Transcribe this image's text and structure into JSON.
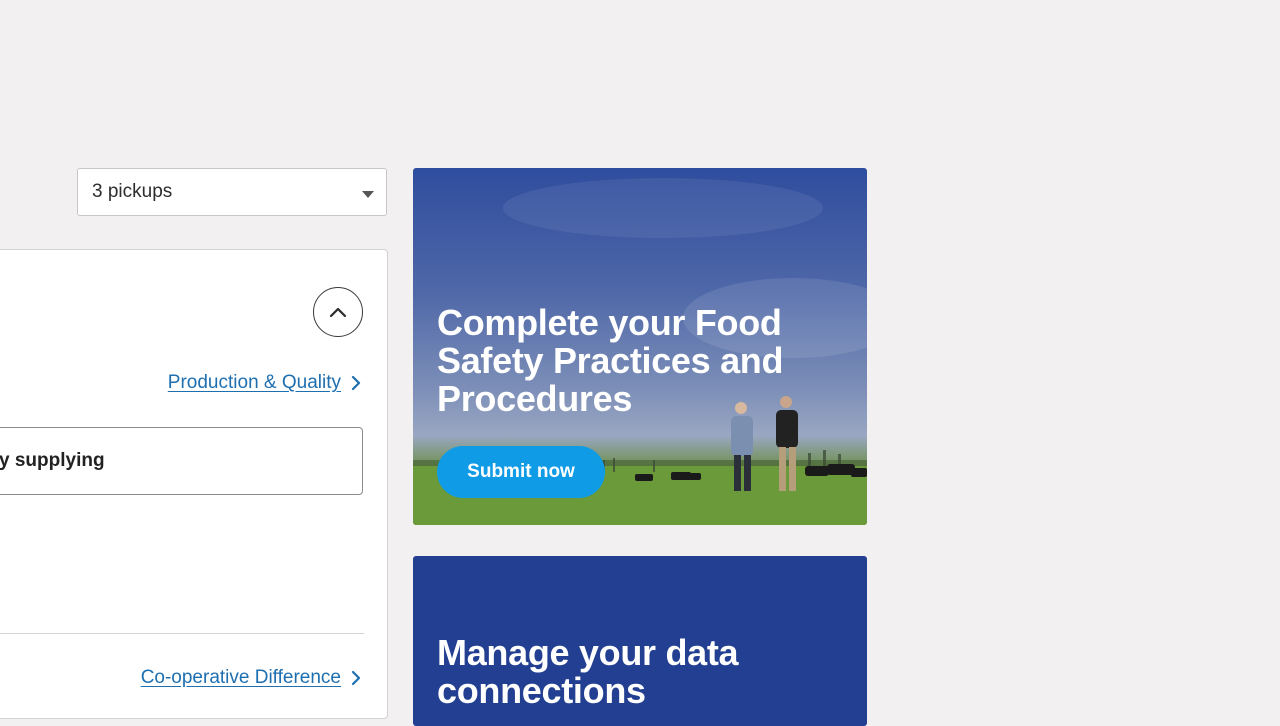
{
  "pickups_select": {
    "value": "3 pickups"
  },
  "production_link": {
    "label": "Production & Quality"
  },
  "supply_field": {
    "text": "y supplying"
  },
  "cooperative_link": {
    "label": "Co-operative Difference"
  },
  "promo_food_safety": {
    "title": "Complete your Food Safety Practices and Procedures",
    "button_label": "Submit now"
  },
  "promo_data": {
    "title": "Manage your data connections"
  },
  "colors": {
    "accent": "#0f9be5",
    "link": "#1e6fb0",
    "navy": "#223f91"
  }
}
